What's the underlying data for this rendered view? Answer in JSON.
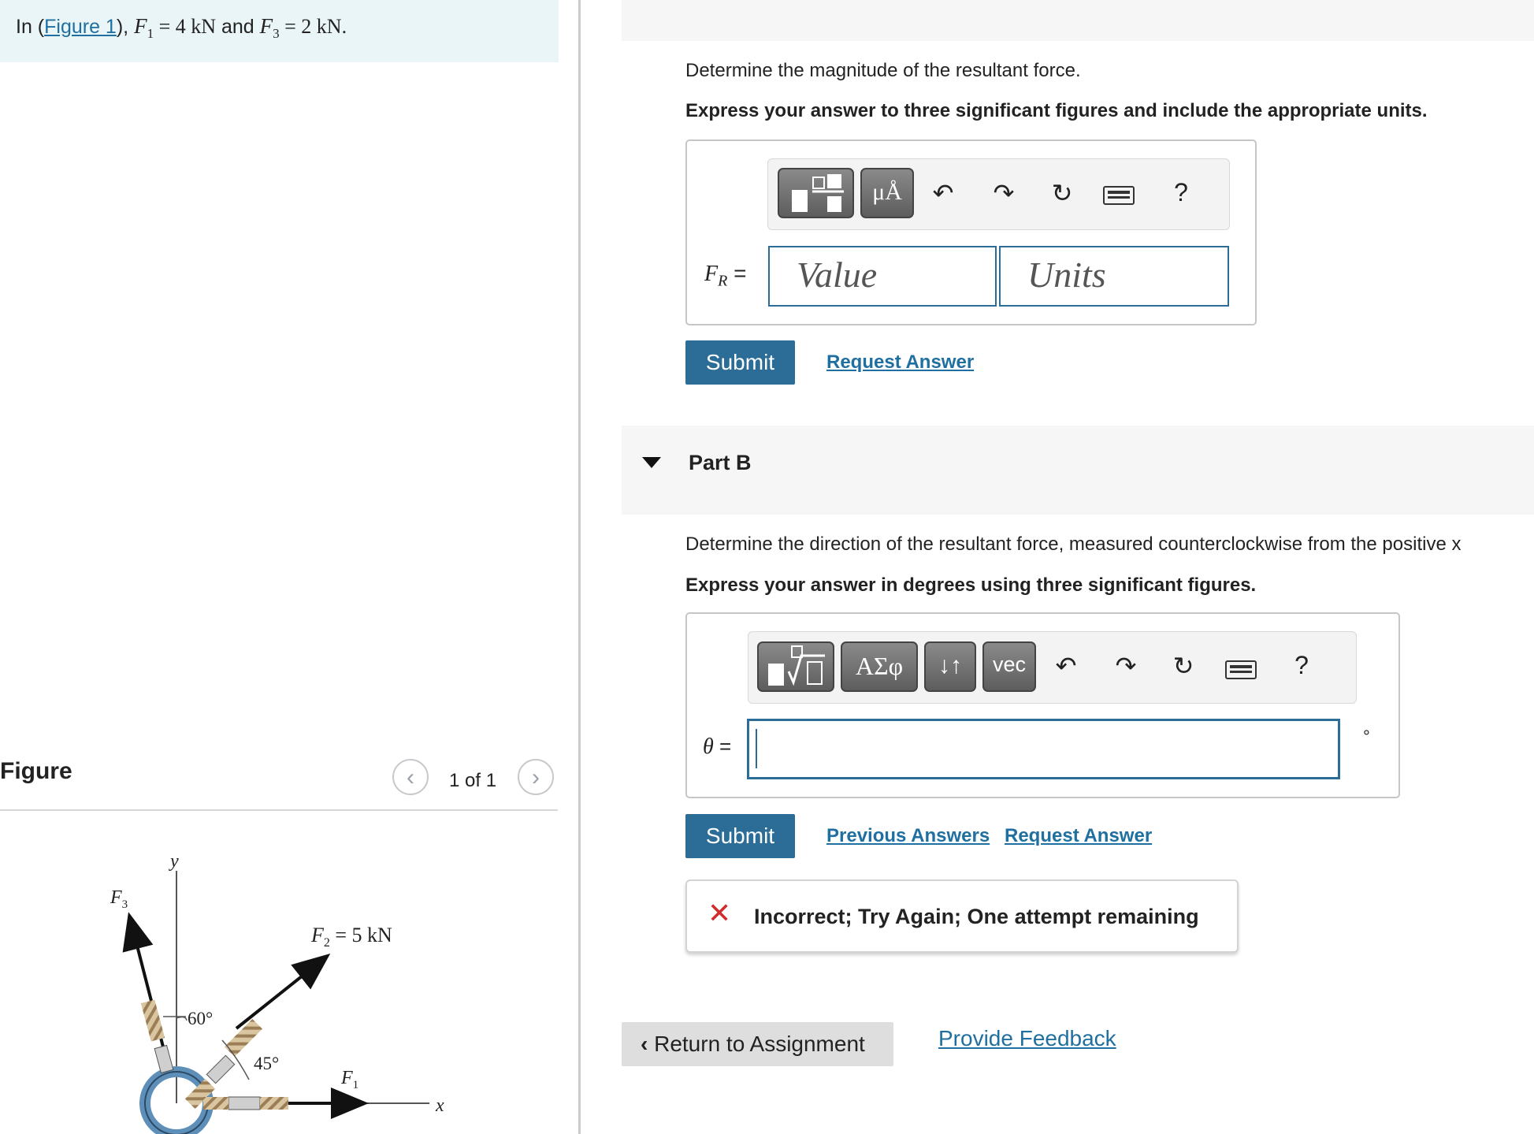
{
  "problem": {
    "prefix": "In (",
    "figure_link": "Figure 1",
    "suffix": "),",
    "f1_sym": "F",
    "f1_sub": "1",
    "f1_val": " = 4 kN",
    "and": " and ",
    "f3_sym": "F",
    "f3_sub": "3",
    "f3_val": " = 2 kN."
  },
  "figure": {
    "title": "Figure",
    "prev_icon": "chevron-left-icon",
    "next_icon": "chevron-right-icon",
    "count": "1 of 1",
    "labels": {
      "y": "y",
      "x": "x",
      "f3": "F",
      "f3_sub": "3",
      "f2": "F",
      "f2_sub": "2",
      "f2_val": " = 5 kN",
      "f1": "F",
      "f1_sub": "1",
      "angle60": "60°",
      "angle45": "45°"
    }
  },
  "part_a": {
    "question": "Determine the magnitude of the resultant force.",
    "instruction": "Express your answer to three significant figures and include the appropriate units.",
    "toolbar": {
      "template_icon": "fraction-template-icon",
      "units_label": "μÅ",
      "undo_icon": "undo-icon",
      "redo_icon": "redo-icon",
      "reset_icon": "reset-icon",
      "keyboard_icon": "keyboard-icon",
      "help_label": "?"
    },
    "variable": "F",
    "variable_sub": "R",
    "equals": " =",
    "value_placeholder": "Value",
    "units_placeholder": "Units",
    "submit_label": "Submit",
    "request_answer": "Request Answer"
  },
  "part_b": {
    "title": "Part B",
    "question": "Determine the direction of the resultant force, measured counterclockwise from the positive x",
    "instruction": "Express your answer in degrees using three significant figures.",
    "toolbar": {
      "template_icon": "sqrt-template-icon",
      "greek_label": "ΑΣφ",
      "arrows_label": "↓↑",
      "vec_label": "vec",
      "undo_icon": "undo-icon",
      "redo_icon": "redo-icon",
      "reset_icon": "reset-icon",
      "keyboard_icon": "keyboard-icon",
      "help_label": "?"
    },
    "variable": "θ",
    "equals": " =",
    "input_value": "",
    "unit_symbol": "°",
    "submit_label": "Submit",
    "previous_answers": "Previous Answers",
    "request_answer": "Request Answer",
    "feedback": "Incorrect; Try Again; One attempt remaining"
  },
  "footer": {
    "return_label": "Return to Assignment",
    "feedback_link": "Provide Feedback"
  },
  "colors": {
    "accent": "#2b6d96",
    "link": "#1f6fa0",
    "error": "#d22b2b",
    "problem_bg": "#eaf5f7"
  }
}
